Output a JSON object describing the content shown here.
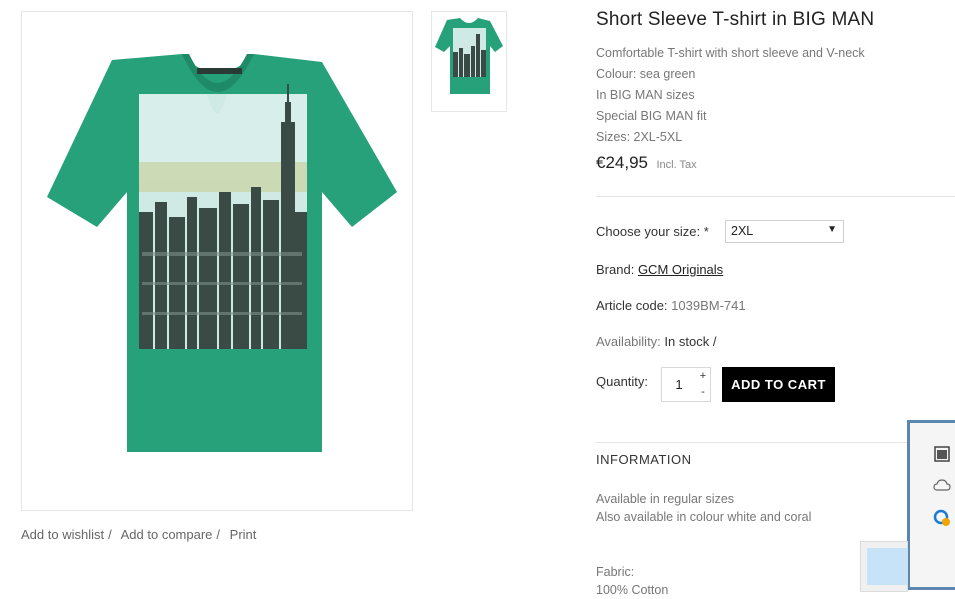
{
  "product": {
    "title": "Short Sleeve T-shirt in BIG MAN",
    "description": [
      "Comfortable T-shirt with short sleeve and V-neck",
      "Colour: sea green",
      "In BIG MAN sizes",
      "Special BIG MAN fit",
      "Sizes: 2XL-5XL"
    ],
    "price": "€24,95",
    "tax_note": "Incl. Tax",
    "shirt_color": "#26a17a"
  },
  "size": {
    "label": "Choose your size:",
    "required_mark": "*",
    "selected": "2XL"
  },
  "brand": {
    "label": "Brand:",
    "value": "GCM Originals"
  },
  "article": {
    "label": "Article code:",
    "value": "1039BM-741"
  },
  "availability": {
    "label": "Availability:",
    "value": "In stock /"
  },
  "quantity": {
    "label": "Quantity:",
    "value": "1",
    "plus": "+",
    "minus": "-"
  },
  "cart": {
    "button_label": "ADD TO CART"
  },
  "image_links": {
    "wishlist": "Add to wishlist",
    "compare": "Add to compare",
    "print": "Print",
    "separator": "/"
  },
  "information": {
    "heading": "INFORMATION",
    "lines": [
      "Available in regular sizes",
      "Also available in colour white and coral"
    ],
    "fabric_label": "Fabric:",
    "fabric_value": "100% Cotton"
  },
  "side_widget": {
    "icons": [
      "window-icon",
      "cloud-icon",
      "edge-browser-icon"
    ]
  }
}
